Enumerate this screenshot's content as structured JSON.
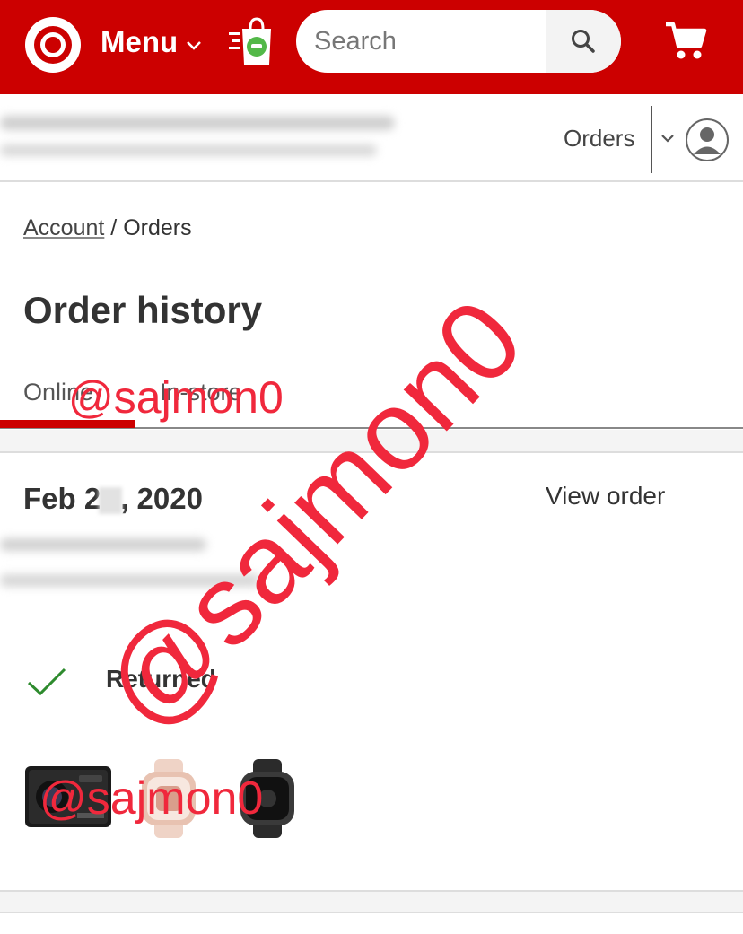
{
  "header": {
    "logo": "target-bullseye-logo",
    "menu_label": "Menu",
    "search_placeholder": "Search",
    "icons": [
      "chevron-down-icon",
      "drive-up-bag-icon",
      "search-icon",
      "cart-icon"
    ]
  },
  "subheader": {
    "orders_label": "Orders",
    "icons": [
      "chevron-down-icon",
      "account-avatar-icon"
    ]
  },
  "breadcrumb": {
    "account": "Account",
    "separator": " / ",
    "current": "Orders"
  },
  "page": {
    "title": "Order history"
  },
  "tabs": [
    {
      "label": "Online",
      "active": true
    },
    {
      "label": "In-store",
      "active": false
    }
  ],
  "order": {
    "date_prefix": "Feb 2",
    "date_suffix": ", 2020",
    "view_label": "View order",
    "status": "Returned",
    "products": [
      "action-camera",
      "smartwatch-rose-gold",
      "smartwatch-black"
    ]
  },
  "watermark": {
    "small_top": "@sajmon0",
    "small_bottom": "@sajmon0",
    "large_diagonal": "@sajmon0"
  },
  "colors": {
    "brand_red": "#cc0000",
    "watermark_red": "#f0283c",
    "check_green": "#2e8b2e",
    "text_dark": "#333333"
  }
}
